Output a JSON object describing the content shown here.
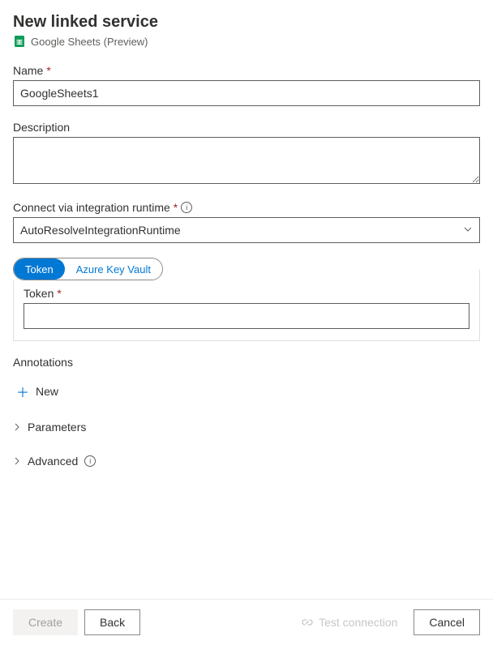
{
  "header": {
    "title": "New linked service",
    "subtitle": "Google Sheets (Preview)"
  },
  "fields": {
    "name": {
      "label": "Name",
      "value": "GoogleSheets1"
    },
    "description": {
      "label": "Description",
      "value": ""
    },
    "runtime": {
      "label": "Connect via integration runtime",
      "value": "AutoResolveIntegrationRuntime"
    },
    "auth": {
      "tabs": {
        "token": "Token",
        "akv": "Azure Key Vault"
      },
      "token_label": "Token",
      "token_value": ""
    }
  },
  "annotations": {
    "label": "Annotations",
    "add_new": "New"
  },
  "expanders": {
    "parameters": "Parameters",
    "advanced": "Advanced"
  },
  "footer": {
    "create": "Create",
    "back": "Back",
    "test": "Test connection",
    "cancel": "Cancel"
  }
}
